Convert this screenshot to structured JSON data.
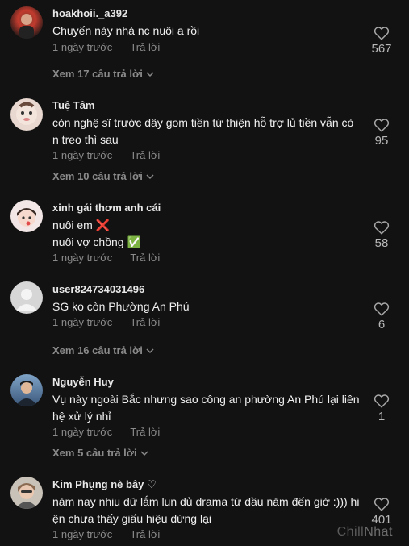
{
  "comments": [
    {
      "username": "hoakhoii._a392",
      "lines": [
        "Chuyến này nhà nc nuôi a rồi"
      ],
      "time": "1 ngày trước",
      "reply": "Trả lời",
      "likes": "567",
      "view_replies": "Xem 17 câu trả lời"
    },
    {
      "username": "Tuệ Tâm",
      "lines": [
        "còn nghệ sĩ trước dây gom tiền từ thiện hỗ trợ lủ tiền vẫn cò",
        "n treo thì sau"
      ],
      "time": "1 ngày trước",
      "reply": "Trả lời",
      "likes": "95",
      "view_replies": "Xem 10 câu trả lời"
    },
    {
      "username": "xinh gái thơm anh cái",
      "lines": [
        "nuôi em ❌",
        "nuôi vợ chồng ✅"
      ],
      "time": "1 ngày trước",
      "reply": "Trả lời",
      "likes": "58"
    },
    {
      "username": "user824734031496",
      "lines": [
        "SG ko còn Phường An Phú"
      ],
      "time": "1 ngày trước",
      "reply": "Trả lời",
      "likes": "6",
      "view_replies": "Xem 16 câu trả lời"
    },
    {
      "username": "Nguyễn Huy",
      "lines": [
        "Vụ này ngoài Bắc nhưng sao công an phường An Phú lại liên",
        "hệ xử lý nhỉ"
      ],
      "time": "1 ngày trước",
      "reply": "Trả lời",
      "likes": "1",
      "view_replies": "Xem 5 câu trả lời"
    },
    {
      "username": "Kim Phụng nè bây ♡",
      "lines": [
        "năm nay nhiu dữ lắm lun dủ drama từ dầu năm đến giờ :))) hi",
        "ện chưa thấy giấu hiệu dừng lại"
      ],
      "time": "1 ngày trước",
      "reply": "Trả lời",
      "likes": "401"
    }
  ],
  "watermark": {
    "part1": "Chill",
    "part2": "Nhat"
  },
  "colors": {
    "background": "#121212",
    "muted": "#8a8a8a",
    "text": "#f0f0f0"
  }
}
